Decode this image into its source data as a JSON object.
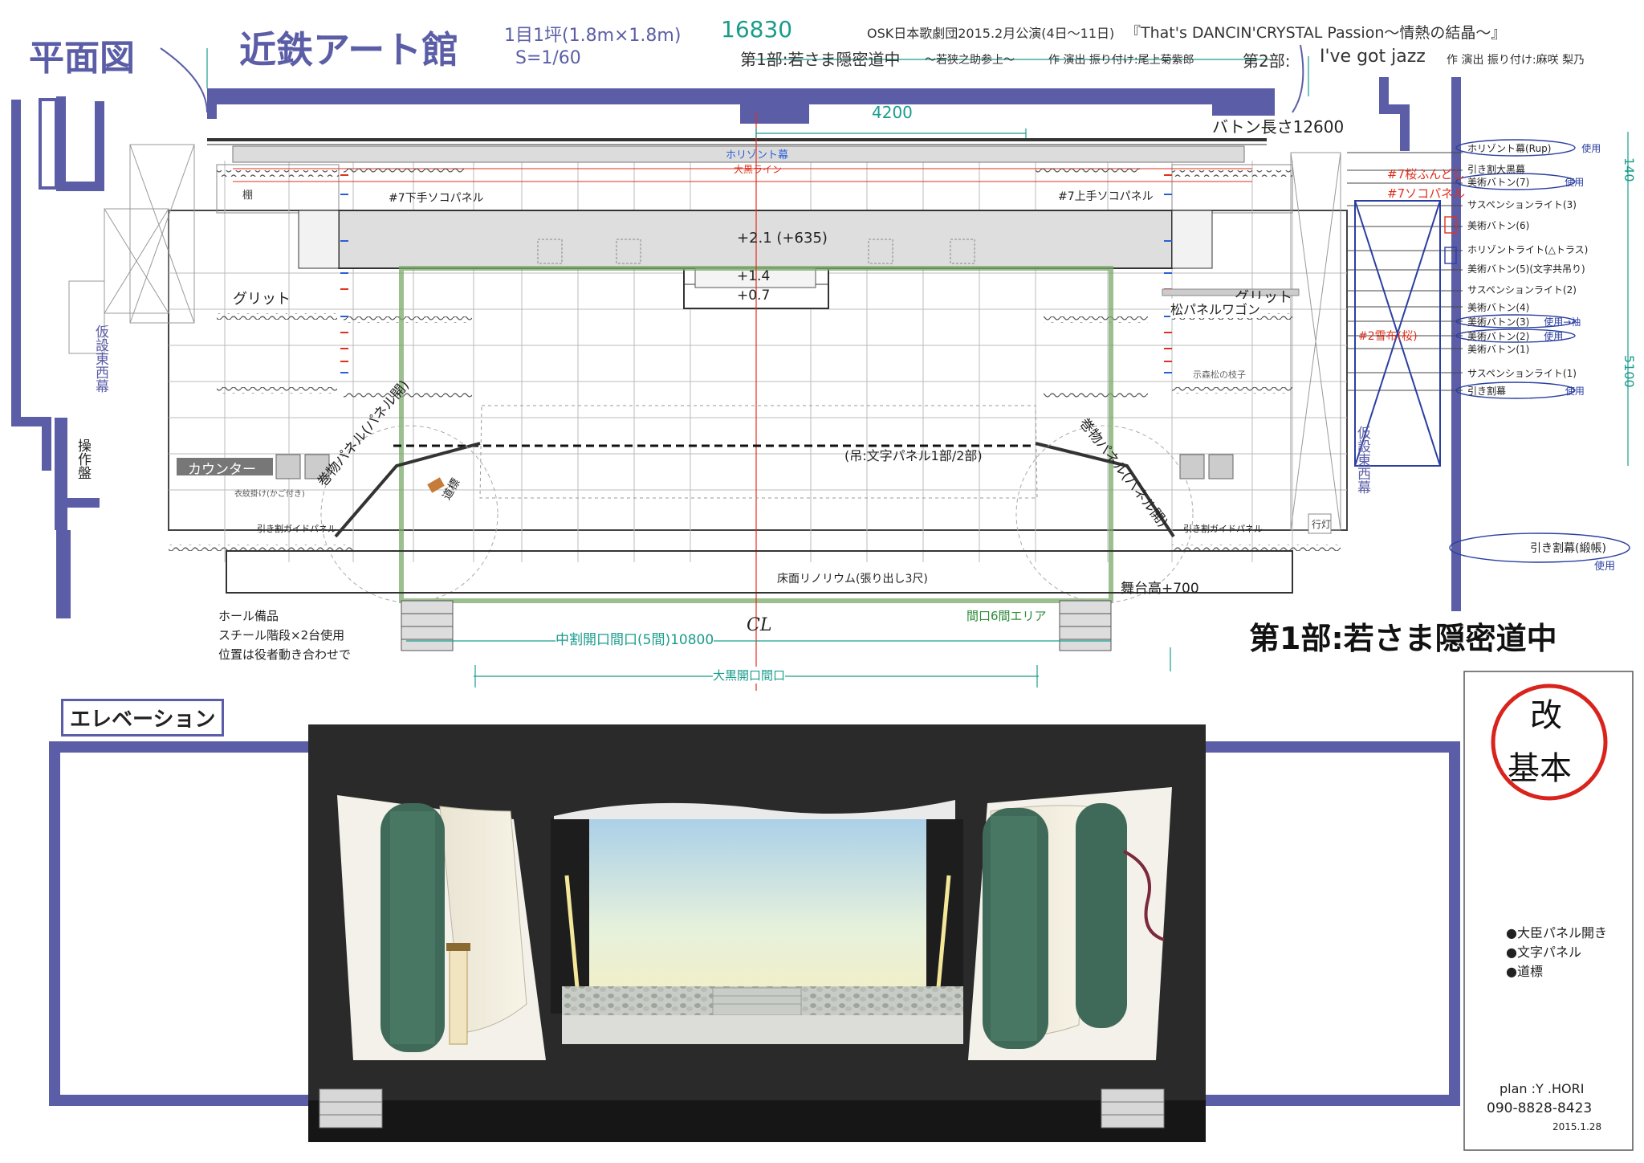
{
  "header": {
    "title": "平面図",
    "venue": "近鉄アート館",
    "grid_note": "1目1坪(1.8m×1.8m)",
    "scale": "S=1/60",
    "width_dim": "16830",
    "company_line": "OSK日本歌劇団2015.2月公演(4日〜11日)",
    "show_title": "『That's DANCIN'CRYSTAL Passion〜情熱の結晶〜』",
    "part1_label": "第1部:若さま隠密道中",
    "part1_sub": "〜若狭之助参上〜",
    "part1_credit": "作 演出 振り付け:尾上菊紫郎",
    "part2_label": "第2部:",
    "part2_title": "I've got jazz",
    "part2_credit": "作 演出 振り付け:麻咲 梨乃"
  },
  "plan": {
    "dim_4200": "4200",
    "batten_length": "バトン長さ12600",
    "horizon_curtain": "ホリゾント幕",
    "okuro_line": "大黒ライン",
    "kamisode_label": "棚",
    "soko_left": "#7下手ソコパネル",
    "soko_right": "#7上手ソコパネル",
    "platform_top": "+2.1 (+635)",
    "platform_mid": "+1.4",
    "platform_low": "+0.7",
    "grid_left": "グリット",
    "grid_right": "グリット",
    "matsu_wagon": "松パネルワゴン",
    "side_note_right": "示森松の枝子",
    "side_left_vertical": "仮設東西幕",
    "side_right_vertical": "仮設東西幕",
    "control_panel": "操作盤",
    "counter": "カウンター",
    "counter_sub": "衣紋掛け(かご付き)",
    "scroll_left": "巻物パネル(パネル開)",
    "scroll_right": "巻物パネル(パネル開)",
    "hanging_text_panel": "(吊:文字パネル1部/2部)",
    "signpost": "道標",
    "guide_left": "引き割ガイドパネル",
    "guide_right": "引き割ガイドパネル",
    "andon": "行灯",
    "floor_linoleum": "床面リノリウム(張り出し3尺)",
    "stage_height": "舞台高+700",
    "opening_6ken": "間口6間エリア",
    "naka_opening": "中割開口間口(5間)10800",
    "okuro_opening": "大黒開口間口",
    "center_line": "CL",
    "hall_note_1": "ホール備品",
    "hall_note_2": "スチール階段×2台使用",
    "hall_note_3": "位置は役者動き合わせで",
    "part1_big": "第1部:若さま隠密道中",
    "dim_140": "140",
    "dim_5100": "5100"
  },
  "batten_list": [
    {
      "label": "ホリゾント幕(Rup)",
      "note": "使用"
    },
    {
      "label": "引き割大黒幕",
      "note": ""
    },
    {
      "label": "美術バトン(7)",
      "note": "使用"
    },
    {
      "label": "サスペンションライト(3)",
      "note": ""
    },
    {
      "label": "美術バトン(6)",
      "note": ""
    },
    {
      "label": "ホリゾントライト(△トラス)",
      "note": ""
    },
    {
      "label": "美術バトン(5)(文字共吊り)",
      "note": ""
    },
    {
      "label": "サスペンションライト(2)",
      "note": ""
    },
    {
      "label": "美術バトン(4)",
      "note": ""
    },
    {
      "label": "美術バトン(3)",
      "note": "使用→袖"
    },
    {
      "label": "美術バトン(2)",
      "note": "使用"
    },
    {
      "label": "美術バトン(1)",
      "note": ""
    },
    {
      "label": "サスペンションライト(1)",
      "note": ""
    },
    {
      "label": "引き割幕",
      "note": "使用"
    },
    {
      "label": "引き割幕(緞帳)",
      "note": "使用"
    }
  ],
  "red_notes": [
    "#7桜ふんどし",
    "#7ソコパネル",
    "#2雪布(桜)"
  ],
  "elevation": {
    "label": "エレベーション",
    "bullets": [
      "●大臣パネル開き",
      "●文字パネル",
      "●道標"
    ],
    "stamp_top": "改",
    "stamp_bottom": "基本",
    "plan_by": "plan :Y .HORI",
    "phone": "090-8828-8423",
    "date": "2015.1.28"
  },
  "colors": {
    "blue_wall": "#5b5ea6",
    "teal": "#1a9c8c",
    "red": "#e0301e",
    "green": "#2e8b3a",
    "stamp_red": "#d9231d"
  }
}
